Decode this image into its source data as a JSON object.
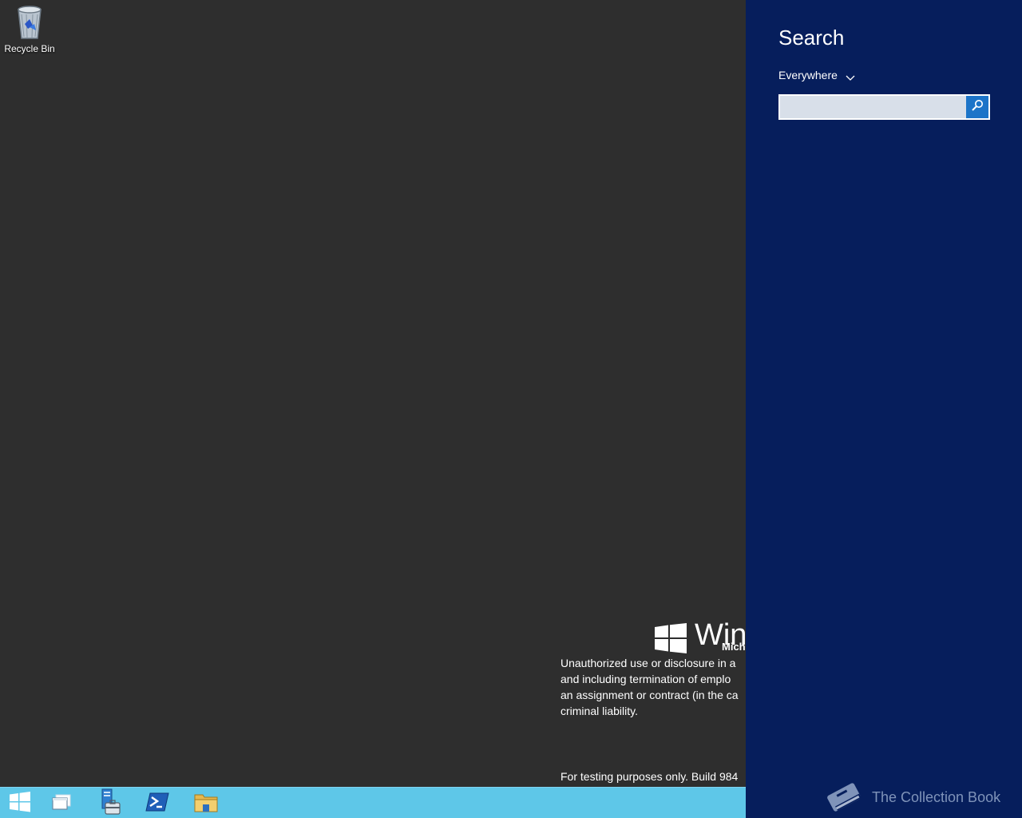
{
  "desktop": {
    "icons": [
      {
        "label": "Recycle Bin",
        "icon": "recycle-bin-icon"
      }
    ],
    "branding": {
      "logo_text": "Winc",
      "sub_text": "Mich"
    },
    "legal_lines": [
      "Unauthorized use or disclosure in a",
      "and including termination of emplo",
      "an assignment or contract (in the ca",
      "criminal liability."
    ],
    "build_text": "For testing purposes only. Build 984"
  },
  "taskbar": {
    "color": "#5ec7e8",
    "items": [
      {
        "icon": "windows-start-icon"
      },
      {
        "icon": "desktop-windows-icon"
      },
      {
        "icon": "server-manager-icon"
      },
      {
        "icon": "powershell-icon"
      },
      {
        "icon": "file-explorer-icon"
      }
    ]
  },
  "search_charm": {
    "title": "Search",
    "scope_label": "Everywhere",
    "input_value": "",
    "input_placeholder": "",
    "background": "#061e5c",
    "accent": "#1c74c8"
  },
  "watermark": {
    "text": "The Collection Book",
    "icon": "book-icon"
  }
}
